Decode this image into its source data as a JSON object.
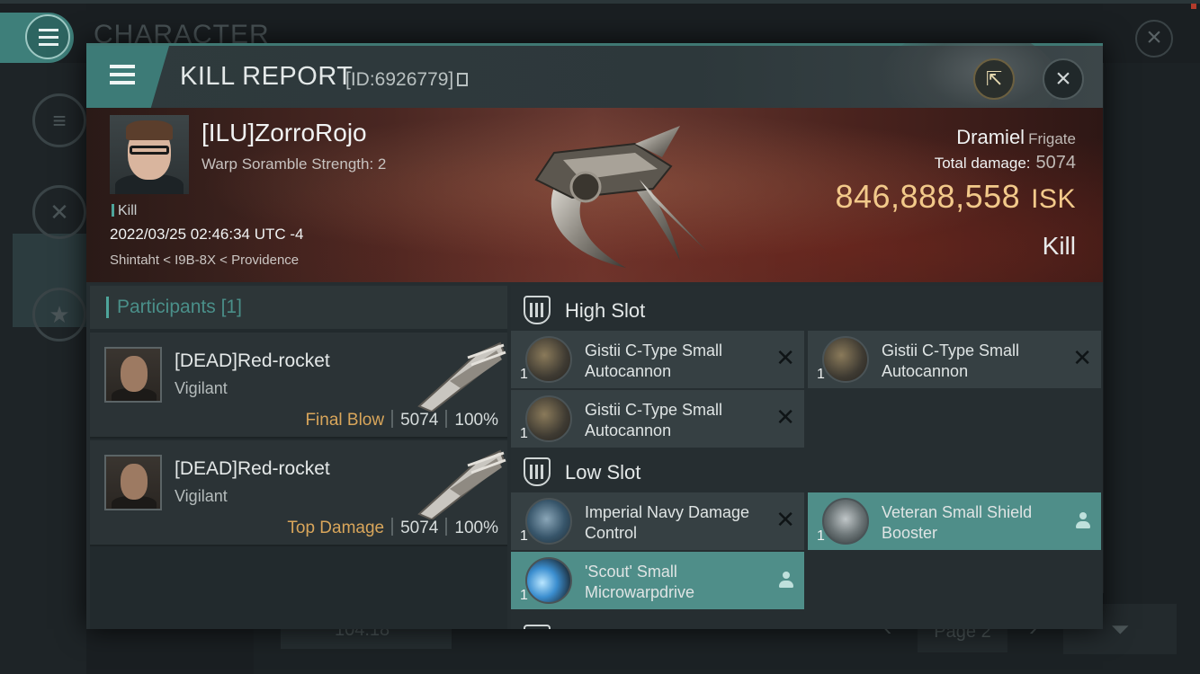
{
  "background": {
    "title": "CHARACTER",
    "stat_value": "104.18",
    "page_label": "Page 2"
  },
  "header": {
    "title": "KILL REPORT",
    "report_id": "[ID:6926779]",
    "icons": [
      "menu-icon",
      "share-icon",
      "close-icon",
      "copy-icon"
    ]
  },
  "victim": {
    "name": "[ILU]ZorroRojo",
    "subtitle": "Warp Soramble Strength: 2",
    "tag": "Kill",
    "datetime": "2022/03/25 02:46:34 UTC -4",
    "location": "Shintaht < I9B-8X < Providence",
    "ship_name": "Dramiel",
    "ship_class": "Frigate",
    "total_damage_label": "Total damage:",
    "total_damage": "5074",
    "isk_value": "846,888,558",
    "isk_unit": "ISK",
    "result": "Kill"
  },
  "participants": {
    "title": "Participants",
    "count": "[1]",
    "rows": [
      {
        "name": "[DEAD]Red-rocket",
        "ship": "Vigilant",
        "role": "Final Blow",
        "damage": "5074",
        "percent": "100%"
      },
      {
        "name": "[DEAD]Red-rocket",
        "ship": "Vigilant",
        "role": "Top Damage",
        "damage": "5074",
        "percent": "100%"
      }
    ]
  },
  "fitting": {
    "high_slot_label": "High Slot",
    "low_slot_label": "Low Slot",
    "high_slot": [
      {
        "name": "Gistii C-Type Small Autocannon",
        "qty": "1",
        "icon": "autocannon-icon"
      },
      {
        "name": "Gistii C-Type Small Autocannon",
        "qty": "1",
        "icon": "autocannon-icon"
      },
      {
        "name": "Gistii C-Type Small Autocannon",
        "qty": "1",
        "icon": "autocannon-icon"
      }
    ],
    "low_slot": [
      {
        "name": "Imperial Navy Damage Control",
        "qty": "1",
        "icon": "damage-control-icon"
      },
      {
        "name": "Veteran Small Shield Booster",
        "qty": "1",
        "icon": "shield-booster-icon"
      },
      {
        "name": "'Scout' Small Microwarpdrive",
        "qty": "1",
        "icon": "microwarpdrive-icon"
      }
    ]
  },
  "colors": {
    "accent": "#3d7b77",
    "isk": "#f2c98a",
    "final_blow": "#d9a65b",
    "highlight_module": "#4f8e89"
  }
}
